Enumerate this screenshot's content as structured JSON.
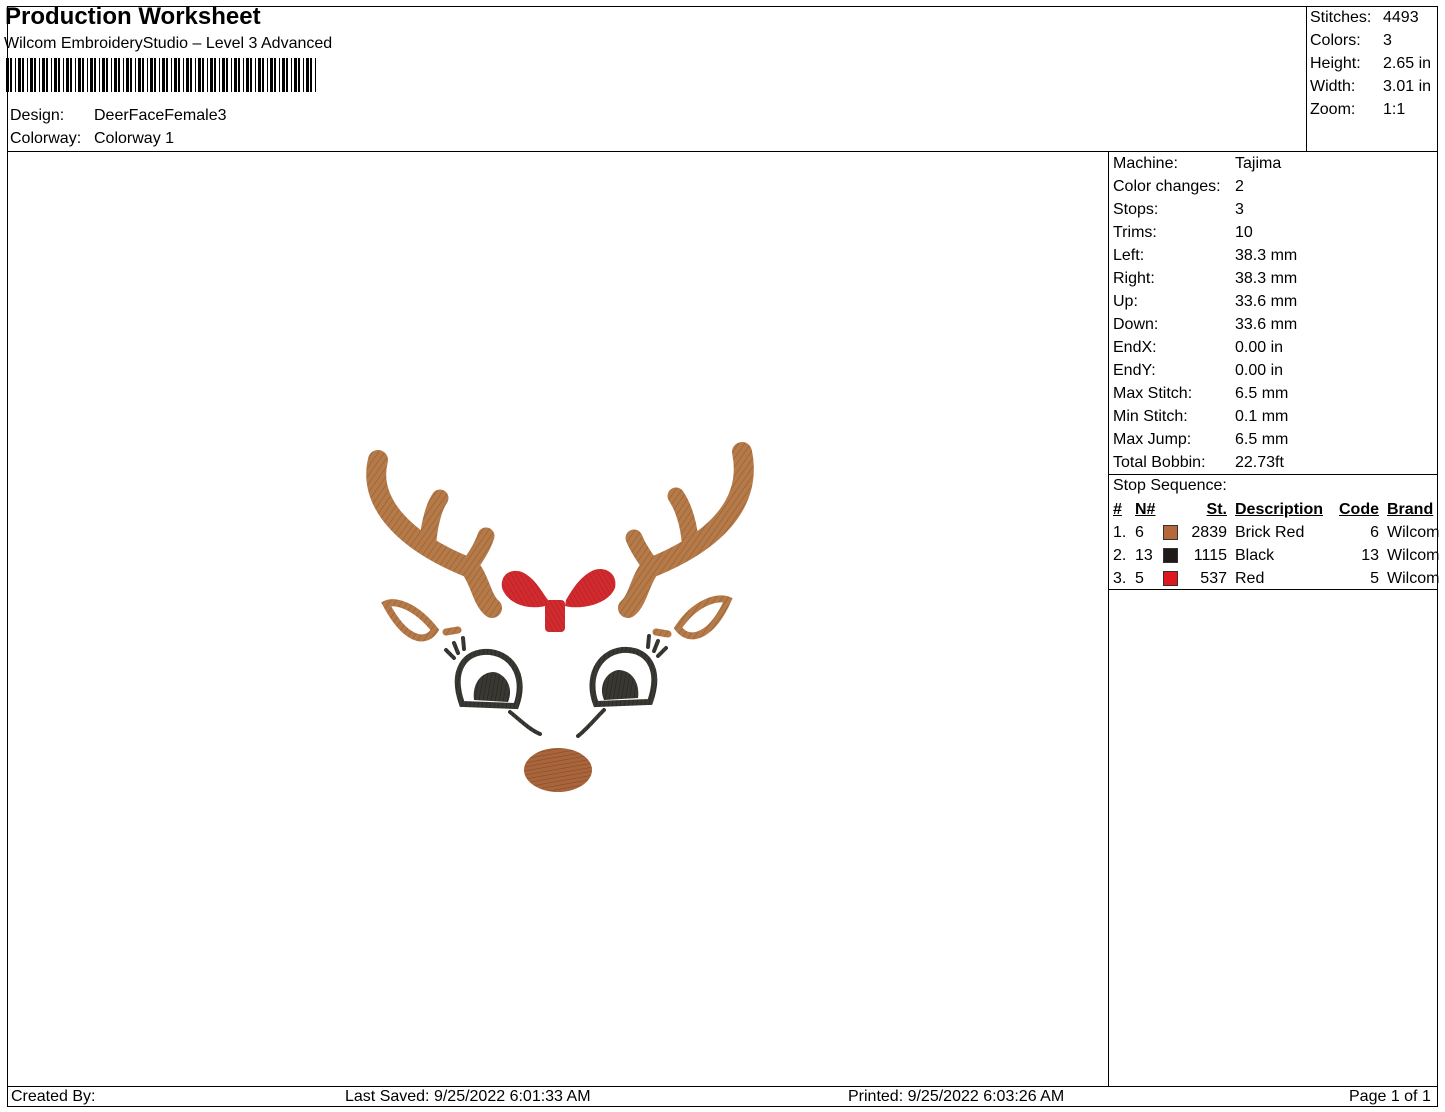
{
  "header": {
    "title": "Production Worksheet",
    "software": "Wilcom EmbroideryStudio – Level 3 Advanced",
    "design_label": "Design:",
    "design_value": "DeerFaceFemale3",
    "colorway_label": "Colorway:",
    "colorway_value": "Colorway 1"
  },
  "stats": [
    {
      "label": "Stitches:",
      "value": "4493"
    },
    {
      "label": "Colors:",
      "value": "3"
    },
    {
      "label": "Height:",
      "value": "2.65 in"
    },
    {
      "label": "Width:",
      "value": "3.01 in"
    },
    {
      "label": "Zoom:",
      "value": "1:1"
    }
  ],
  "machine_info": [
    {
      "label": "Machine:",
      "value": "Tajima"
    },
    {
      "label": "Color changes:",
      "value": "2"
    },
    {
      "label": "Stops:",
      "value": "3"
    },
    {
      "label": "Trims:",
      "value": "10"
    },
    {
      "label": "Left:",
      "value": "38.3 mm"
    },
    {
      "label": "Right:",
      "value": "38.3 mm"
    },
    {
      "label": "Up:",
      "value": "33.6 mm"
    },
    {
      "label": "Down:",
      "value": "33.6 mm"
    },
    {
      "label": "EndX:",
      "value": "0.00 in"
    },
    {
      "label": "EndY:",
      "value": "0.00 in"
    },
    {
      "label": "Max Stitch:",
      "value": "6.5 mm"
    },
    {
      "label": "Min Stitch:",
      "value": "0.1 mm"
    },
    {
      "label": "Max Jump:",
      "value": "6.5 mm"
    },
    {
      "label": "Total Bobbin:",
      "value": "22.73ft"
    }
  ],
  "stop_sequence": {
    "title": "Stop Sequence:",
    "headers": {
      "num": "#",
      "n": "N#",
      "st": "St.",
      "description": "Description",
      "code": "Code",
      "brand": "Brand"
    },
    "rows": [
      {
        "num": "1.",
        "n": "6",
        "color": "#b5683a",
        "st": "2839",
        "description": "Brick Red",
        "code": "6",
        "brand": "Wilcom"
      },
      {
        "num": "2.",
        "n": "13",
        "color": "#1f1a17",
        "st": "1115",
        "description": "Black",
        "code": "13",
        "brand": "Wilcom"
      },
      {
        "num": "3.",
        "n": "5",
        "color": "#e0161e",
        "st": "537",
        "description": "Red",
        "code": "5",
        "brand": "Wilcom"
      }
    ]
  },
  "footer": {
    "created_by": "Created By:",
    "last_saved": "Last Saved: 9/25/2022 6:01:33 AM",
    "printed": "Printed: 9/25/2022 6:03:26 AM",
    "page": "Page 1 of 1"
  },
  "design_colors": {
    "antler": "#b57a48",
    "bow": "#d12a2f",
    "eye": "#3a3833",
    "nose": "#a8643a"
  }
}
